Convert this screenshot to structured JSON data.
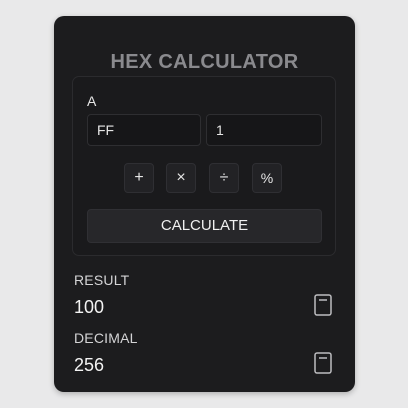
{
  "app": {
    "title": "HEX CALCULATOR"
  },
  "input": {
    "label": "A",
    "operand_a": "FF",
    "operand_b": "1"
  },
  "operators": {
    "plus": "+",
    "times": "×",
    "divide": "÷",
    "percent": "%"
  },
  "calculate_label": "CALCULATE",
  "result": {
    "label": "RESULT",
    "value": "100"
  },
  "decimal": {
    "label": "DECIMAL",
    "value": "256"
  },
  "icons": {
    "copy": "copy-icon"
  },
  "colors": {
    "card_background": "#1c1c1e",
    "title": "#8a8a8e",
    "text": "#e6e6e6"
  }
}
